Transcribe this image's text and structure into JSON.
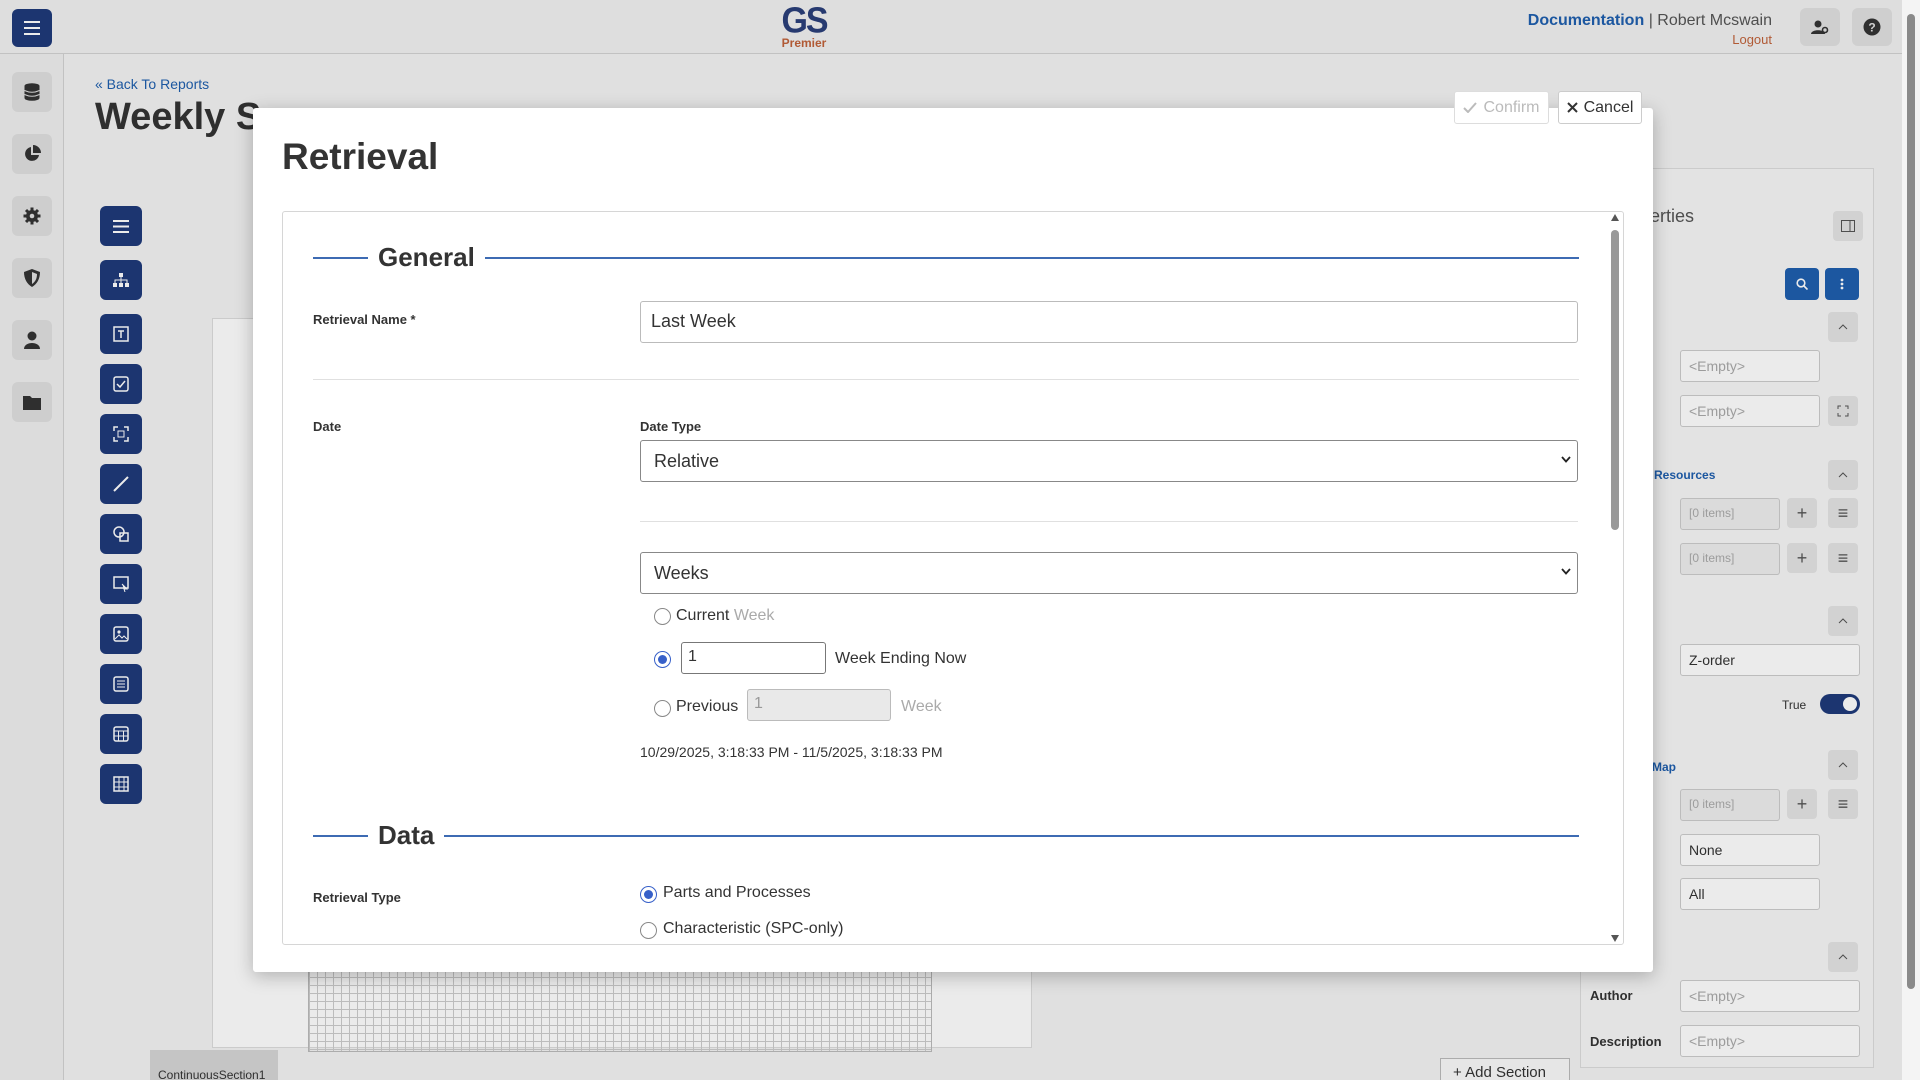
{
  "header": {
    "logo_main": "GS",
    "logo_sub": "Premier",
    "documentation_link": "Documentation",
    "separator": "|",
    "user_name": "Robert Mcswain",
    "logout_link": "Logout"
  },
  "background": {
    "back_link": "« Back To Reports",
    "page_title": "Weekly S",
    "section_tab": "ContinuousSection1",
    "add_section_button": "+  Add Section",
    "properties_tab": "erties",
    "fields": {
      "empty_1": "<Empty>",
      "empty_2": "<Empty>",
      "resources_link": "Resources",
      "items_1": "[0 items]",
      "items_2": "[0 items]",
      "z_order": "Z-order",
      "true_label": "True",
      "map_link": "Map",
      "items_3": "[0 items]",
      "none_value": "None",
      "all_value": "All",
      "author_label": "Author",
      "author_value": "<Empty>",
      "description_label": "Description",
      "description_value": "<Empty>"
    }
  },
  "modal": {
    "title": "Retrieval",
    "confirm_button": "Confirm",
    "cancel_button": "Cancel",
    "general_section": "General",
    "retrieval_name_label": "Retrieval Name *",
    "retrieval_name_value": "Last Week",
    "date_label": "Date",
    "date_type_label": "Date Type",
    "date_type_value": "Relative",
    "period_value": "Weeks",
    "current_label": "Current",
    "current_unit": "Week",
    "count_value": "1",
    "ending_now_label": "Week Ending Now",
    "previous_label": "Previous",
    "previous_value": "1",
    "previous_unit": "Week",
    "date_range": "10/29/2025, 3:18:33 PM - 11/5/2025, 3:18:33 PM",
    "data_section": "Data",
    "retrieval_type_label": "Retrieval Type",
    "retrieval_type_options": [
      "Parts and Processes",
      "Characteristic (SPC-only)"
    ],
    "selected_period_option": "count"
  }
}
